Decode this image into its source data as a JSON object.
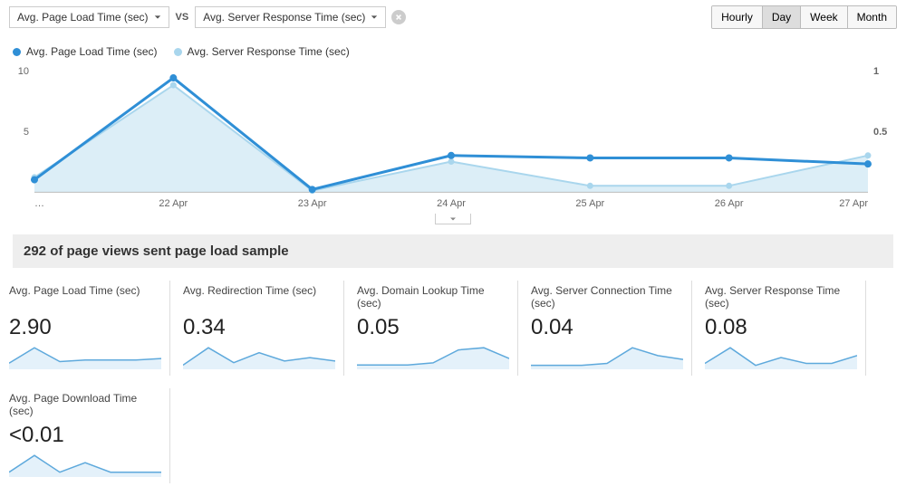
{
  "selectors": {
    "metric_a": "Avg. Page Load Time (sec)",
    "vs": "VS",
    "metric_b": "Avg. Server Response Time (sec)"
  },
  "time_buttons": [
    "Hourly",
    "Day",
    "Week",
    "Month"
  ],
  "time_active": "Day",
  "legend": {
    "a": "Avg. Page Load Time (sec)",
    "b": "Avg. Server Response Time (sec)"
  },
  "chart_data": {
    "type": "line",
    "categories": [
      "…",
      "22 Apr",
      "23 Apr",
      "24 Apr",
      "25 Apr",
      "26 Apr",
      "27 Apr"
    ],
    "y_left_ticks": [
      5,
      10
    ],
    "y_right_ticks": [
      0.5,
      1
    ],
    "ylim_left": [
      0,
      10
    ],
    "ylim_right": [
      0,
      1
    ],
    "series": [
      {
        "name": "Avg. Page Load Time (sec)",
        "axis": "left",
        "color": "#2f8fd6",
        "values": [
          1.0,
          9.4,
          0.2,
          3.0,
          2.8,
          2.8,
          2.3
        ]
      },
      {
        "name": "Avg. Server Response Time (sec)",
        "axis": "right",
        "color": "#a9d6ed",
        "values": [
          0.12,
          0.88,
          0.01,
          0.25,
          0.05,
          0.05,
          0.3
        ]
      }
    ]
  },
  "sample_text": "292 of page views sent page load sample",
  "metrics": [
    {
      "title": "Avg. Page Load Time (sec)",
      "value": "2.90",
      "spark": [
        8,
        28,
        10,
        12,
        12,
        12,
        14
      ]
    },
    {
      "title": "Avg. Redirection Time (sec)",
      "value": "0.34",
      "spark": [
        5,
        26,
        8,
        20,
        10,
        14,
        10
      ]
    },
    {
      "title": "Avg. Domain Lookup Time (sec)",
      "value": "0.05",
      "spark": [
        4,
        4,
        4,
        6,
        18,
        20,
        10
      ]
    },
    {
      "title": "Avg. Server Connection Time (sec)",
      "value": "0.04",
      "spark": [
        4,
        4,
        4,
        6,
        22,
        14,
        10
      ]
    },
    {
      "title": "Avg. Server Response Time (sec)",
      "value": "0.08",
      "spark": [
        6,
        22,
        4,
        12,
        6,
        6,
        14
      ]
    },
    {
      "title": "Avg. Page Download Time (sec)",
      "value": "<0.01",
      "spark": [
        4,
        18,
        4,
        12,
        4,
        4,
        4
      ]
    }
  ]
}
